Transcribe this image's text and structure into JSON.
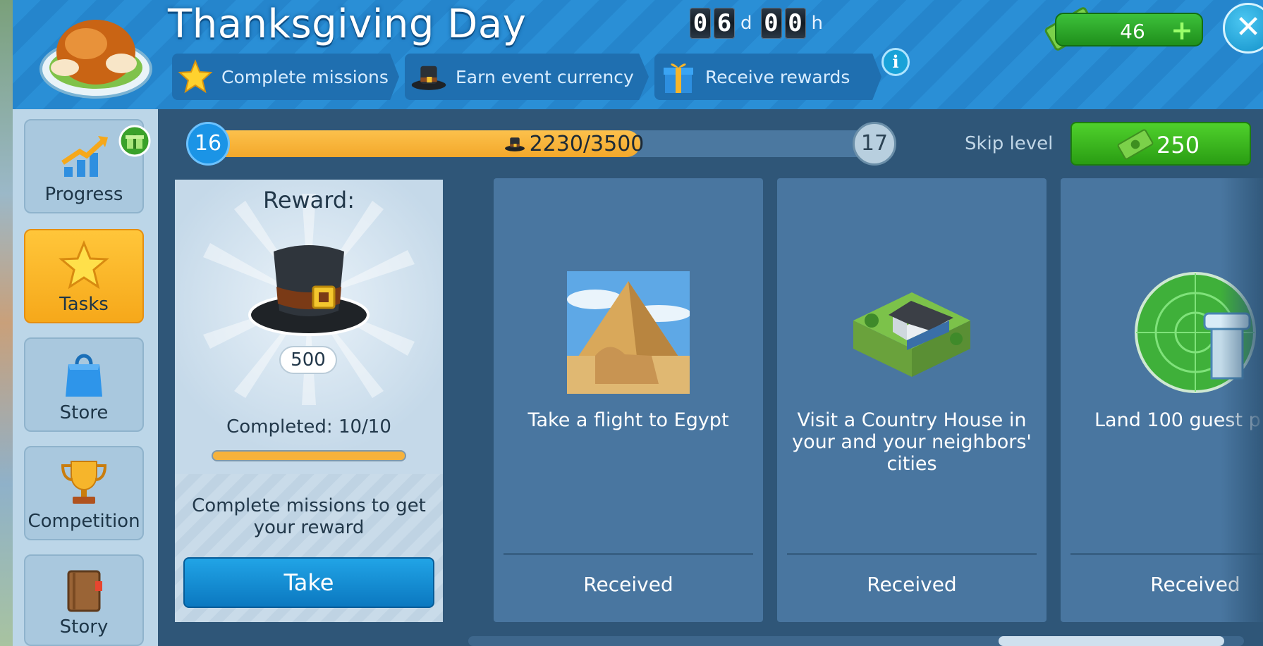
{
  "event": {
    "title": "Thanksgiving Day",
    "timer": {
      "days_digits": [
        "0",
        "6"
      ],
      "days_unit": "d",
      "hours_digits": [
        "0",
        "0"
      ],
      "hours_unit": "h"
    },
    "steps": [
      {
        "label": "Complete missions",
        "icon": "star-icon"
      },
      {
        "label": "Earn event currency",
        "icon": "pilgrim-hat-icon"
      },
      {
        "label": "Receive rewards",
        "icon": "gift-box-icon"
      }
    ],
    "info_glyph": "i"
  },
  "wallet": {
    "cash": "46",
    "plus_glyph": "+"
  },
  "close_glyph": "✕",
  "sidebar": [
    {
      "label": "Progress",
      "icon": "progress-chart-icon",
      "active": false
    },
    {
      "label": "Tasks",
      "icon": "star-icon",
      "active": true
    },
    {
      "label": "Store",
      "icon": "shopping-bag-icon",
      "active": false
    },
    {
      "label": "Competition",
      "icon": "trophy-icon",
      "active": false
    },
    {
      "label": "Story",
      "icon": "book-icon",
      "active": false
    }
  ],
  "progress": {
    "current_level": "16",
    "next_level": "17",
    "text": "2230/3500",
    "fraction": 0.637,
    "skip_label": "Skip level",
    "skip_cost": "250"
  },
  "reward": {
    "title": "Reward:",
    "amount": "500",
    "completed": "Completed: 10/10",
    "completed_fraction": 1.0,
    "note": "Complete missions to get your reward",
    "take_label": "Take"
  },
  "tasks": [
    {
      "title": "Take a flight to Egypt",
      "status": "Received",
      "image": "pyramid-sphinx-image"
    },
    {
      "title": "Visit a Country House in your and your neighbors' cities",
      "status": "Received",
      "image": "country-house-image"
    },
    {
      "title": "Land 100 guest p",
      "status": "Received",
      "image": "radar-tower-image"
    }
  ],
  "colors": {
    "accent_yellow": "#f6a81a",
    "header_blue": "#2a8fd6",
    "green_button": "#2a9d13",
    "take_blue": "#0b78c0"
  }
}
